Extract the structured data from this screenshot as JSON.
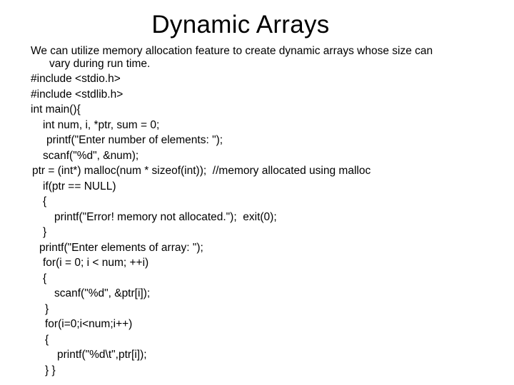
{
  "slide": {
    "title": "Dynamic Arrays",
    "intro_line1": "We can utilize memory allocation feature to create dynamic arrays whose size can",
    "intro_line2": "vary during run time.",
    "code_lines": [
      "#include <stdio.h>",
      "#include <stdlib.h>",
      "int main(){",
      "int num, i, *ptr, sum = 0;",
      "printf(\"Enter number of elements: \");",
      "scanf(\"%d\", &num);",
      "ptr = (int*) malloc(num * sizeof(int));  //memory allocated using malloc",
      "if(ptr == NULL)",
      "{",
      "printf(\"Error! memory not allocated.\");  exit(0);",
      "}",
      "printf(\"Enter elements of array: \");",
      "for(i = 0; i < num; ++i)",
      "{",
      "scanf(\"%d\", &ptr[i]);",
      "}",
      "for(i=0;i<num;i++)",
      "{",
      "printf(\"%d\\t\",ptr[i]);",
      "} }"
    ]
  }
}
